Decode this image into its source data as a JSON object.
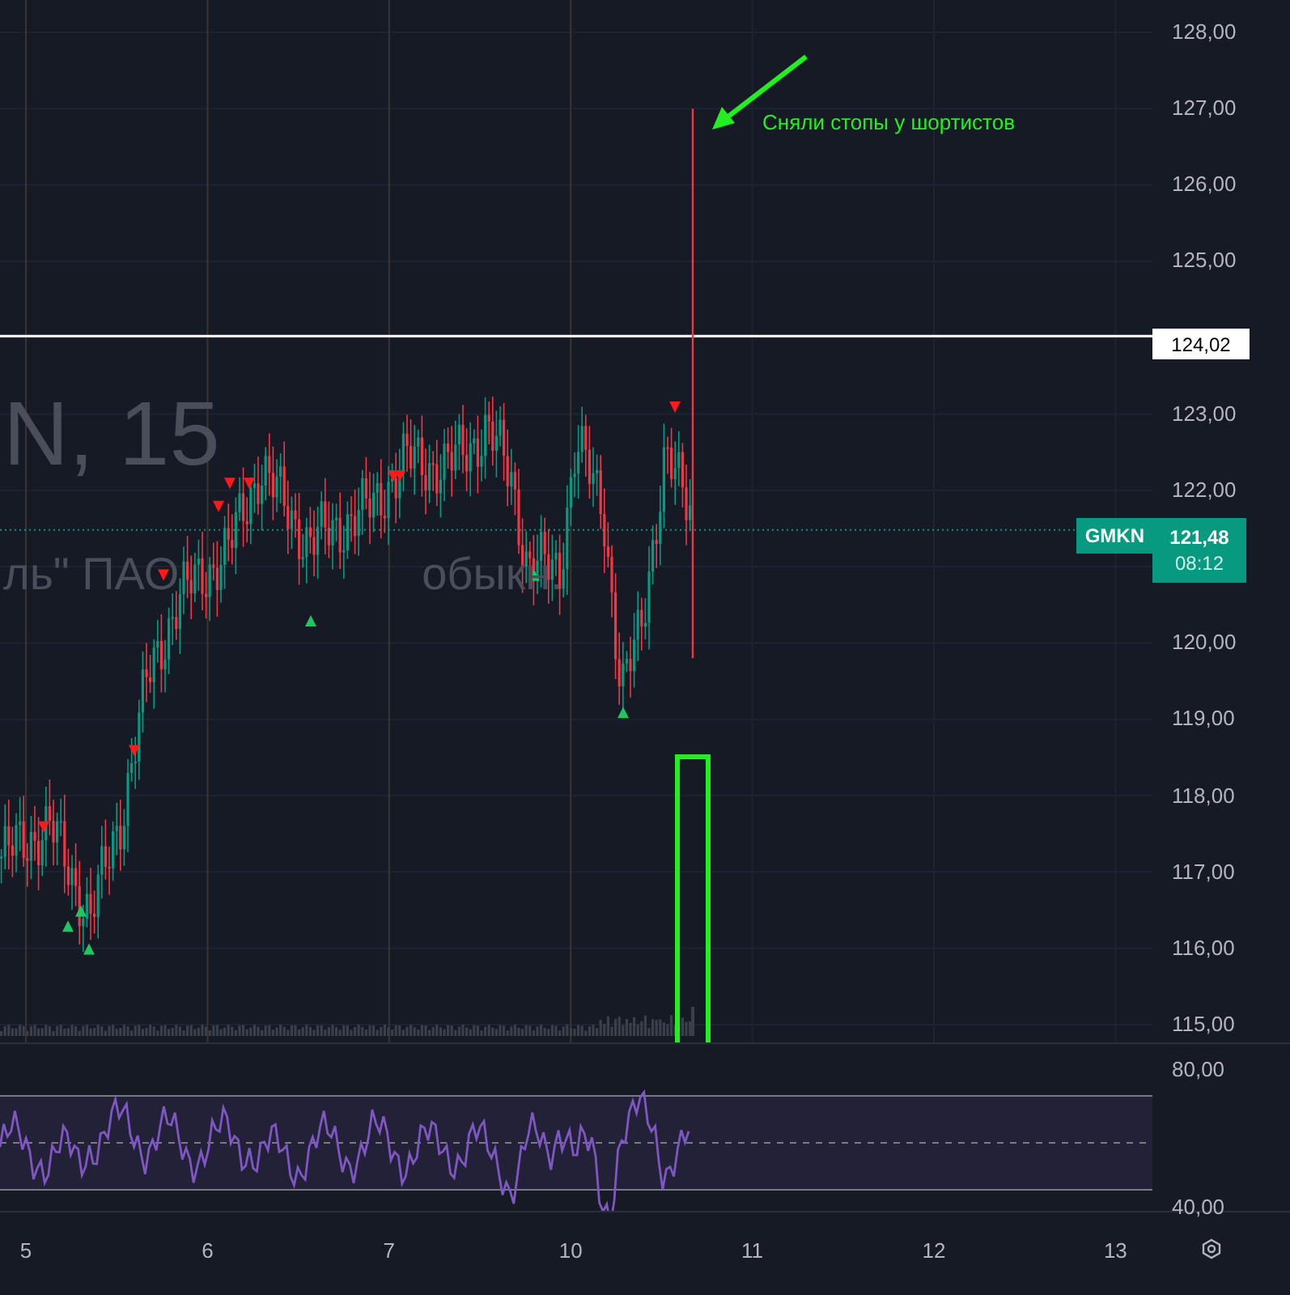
{
  "watermark": {
    "symbol_line": "N, 15",
    "name_parts": [
      "ль\" ПАО",
      "обыкн."
    ]
  },
  "annotation": {
    "text": "Сняли стопы у шортистов"
  },
  "price_axis": {
    "ticks": [
      "128,00",
      "127,00",
      "126,00",
      "125,00",
      "123,00",
      "122,00",
      "120,00",
      "119,00",
      "118,00",
      "117,00",
      "116,00",
      "115,00"
    ],
    "level_line": {
      "label": "124,02"
    },
    "current_price": {
      "symbol": "GMKN",
      "price": "121,48",
      "countdown": "08:12"
    }
  },
  "rsi_axis": {
    "ticks": [
      "80,00",
      "40,00"
    ]
  },
  "time_axis": {
    "labels": [
      "5",
      "6",
      "7",
      "10",
      "11",
      "12",
      "13"
    ]
  }
}
